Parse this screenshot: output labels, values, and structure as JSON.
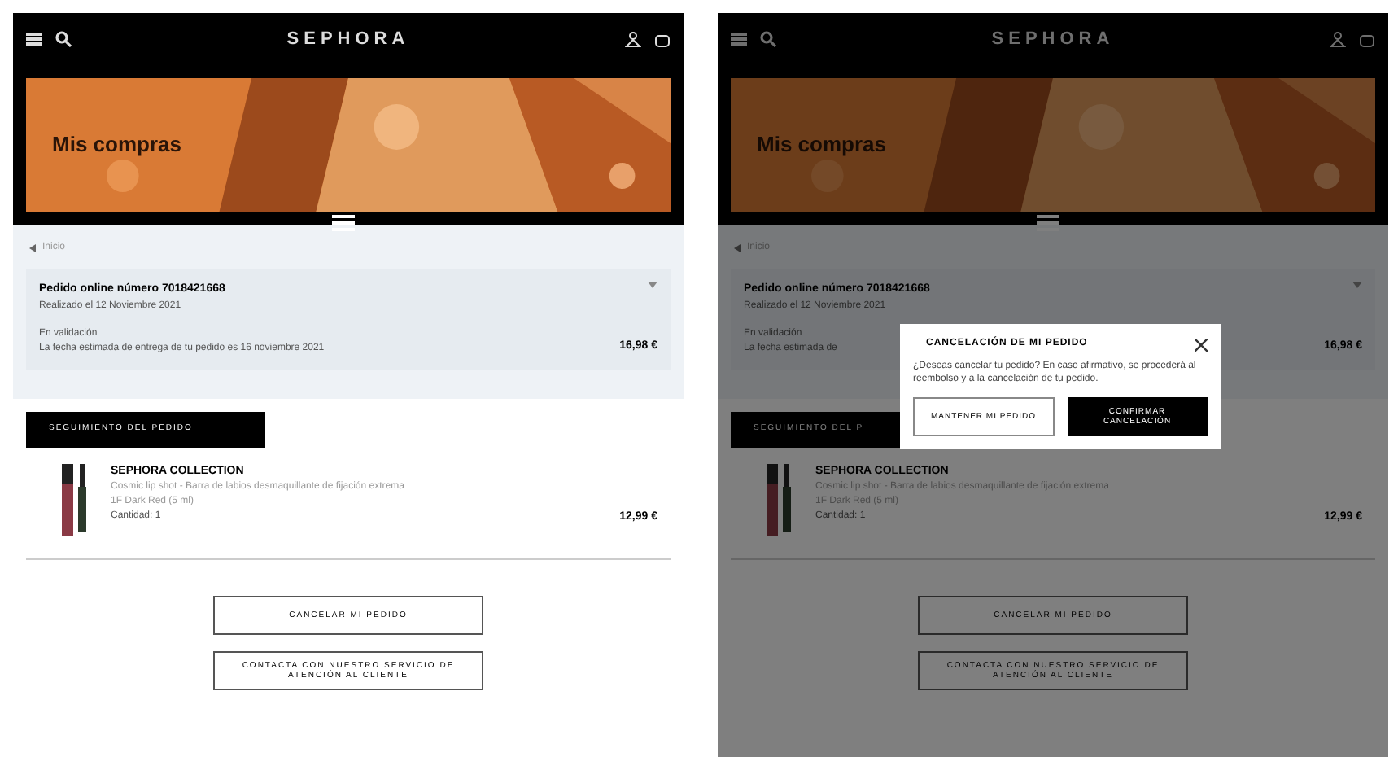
{
  "screens": [
    {
      "header": {
        "logo": "SEPHORA"
      },
      "banner": {
        "title": "Mis compras"
      },
      "breadcrumb": "Inicio",
      "order": {
        "number": "Pedido online número 7018421668",
        "date": "Realizado el 12 Noviembre 2021",
        "status": "En validación",
        "delivery": "La fecha estimada de entrega de tu pedido es 16 noviembre 2021",
        "total": "16,98 €"
      },
      "tracking_button": "SEGUIMIENTO DEL PEDIDO",
      "product": {
        "brand": "SEPHORA COLLECTION",
        "name": "Cosmic lip shot - Barra de labios desmaquillante de fijación extrema",
        "variant": "1F Dark Red (5 ml)",
        "quantity": "Cantidad: 1",
        "price": "12,99 €"
      },
      "actions": [
        "CANCELAR MI PEDIDO",
        "CONTACTA CON NUESTRO SERVICIO DE ATENCIÓN AL CLIENTE"
      ]
    },
    {
      "header": {
        "logo": "SEPHORA"
      },
      "banner": {
        "title": "Mis compras"
      },
      "breadcrumb": "Inicio",
      "order": {
        "number": "Pedido online número 7018421668",
        "date": "Realizado el 12 Noviembre 2021",
        "status": "En validación",
        "delivery": "La fecha estimada de",
        "total": "16,98 €"
      },
      "tracking_button": "SEGUIMIENTO DEL P",
      "product": {
        "brand": "SEPHORA COLLECTION",
        "name": "Cosmic lip shot - Barra de labios desmaquillante de fijación extrema",
        "variant": "1F Dark Red (5 ml)",
        "quantity": "Cantidad: 1",
        "price": "12,99 €"
      },
      "actions": [
        "CANCELAR MI PEDIDO",
        "CONTACTA CON NUESTRO SERVICIO DE ATENCIÓN AL CLIENTE"
      ],
      "dialog": {
        "title": "CANCELACIÓN DE MI PEDIDO",
        "message": "¿Deseas cancelar tu pedido? En caso afirmativo, se procederá al reembolso y a la cancelación de tu pedido.",
        "buttons": [
          {
            "label": "MANTENER MI PEDIDO",
            "kind": "secondary"
          },
          {
            "label": "CONFIRMAR CANCELACIÓN",
            "kind": "primary"
          }
        ]
      }
    }
  ]
}
